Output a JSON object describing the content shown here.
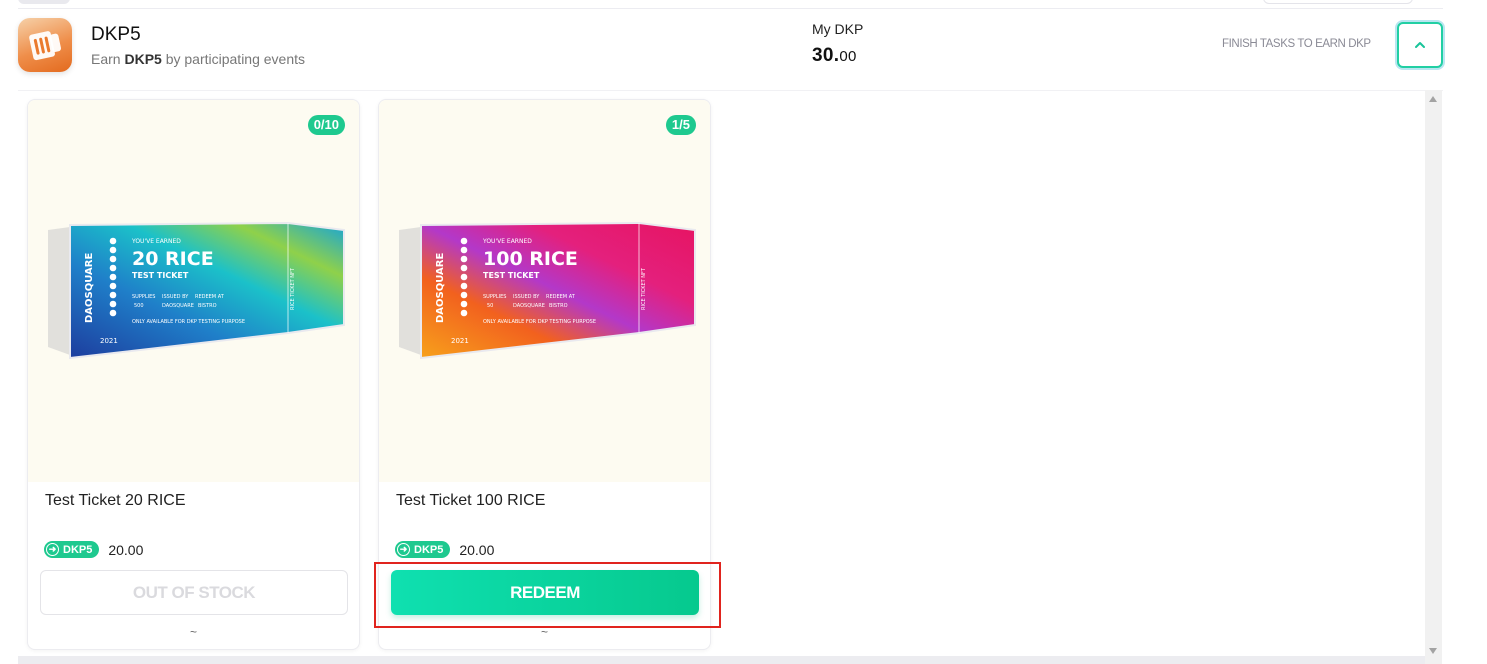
{
  "header": {
    "title": "DKP5",
    "subtitle_prefix": "Earn",
    "subtitle_token": "DKP5",
    "subtitle_suffix": "by participating events",
    "my_dkp_label": "My DKP",
    "my_dkp_int": "30.",
    "my_dkp_dec": "00",
    "finish_tasks": "FINISH TASKS TO EARN DKP",
    "logo_icon": "rice-ticket-logo-icon",
    "collapse_icon": "chevron-up-icon"
  },
  "products": [
    {
      "badge": "0/10",
      "name": "Test Ticket 20 RICE",
      "token": "DKP5",
      "price": "20.00",
      "button": "OUT OF STOCK",
      "button_state": "disabled",
      "footer": "~",
      "ticket": {
        "earned": "YOU'VE EARNED",
        "amount": "20 RICE",
        "kind": "TEST TICKET",
        "brand": "DAOSQUARE",
        "year": "2021",
        "supplies_label": "SUPPLIES",
        "supplies": "500",
        "issued_label": "ISSUED BY",
        "issuer": "DAOSQUARE",
        "redeem_label": "REDEEM AT",
        "redeem_at": "BISTRO",
        "note": "ONLY AVAILABLE FOR DKP TESTING PURPOSE",
        "stub": "RICE TICKET NFT"
      }
    },
    {
      "badge": "1/5",
      "name": "Test Ticket 100 RICE",
      "token": "DKP5",
      "price": "20.00",
      "button": "REDEEM",
      "button_state": "enabled",
      "footer": "~",
      "ticket": {
        "earned": "YOU'VE EARNED",
        "amount": "100 RICE",
        "kind": "TEST TICKET",
        "brand": "DAOSQUARE",
        "year": "2021",
        "supplies_label": "SUPPLIES",
        "supplies": "50",
        "issued_label": "ISSUED BY",
        "issuer": "DAOSQUARE",
        "redeem_label": "REDEEM AT",
        "redeem_at": "BISTRO",
        "note": "ONLY AVAILABLE FOR DKP TESTING PURPOSE",
        "stub": "RICE TICKET NFT"
      }
    }
  ],
  "colors": {
    "accent": "#1ec98f",
    "highlight": "#e0241e",
    "card_bg": "#fdfbf1"
  }
}
